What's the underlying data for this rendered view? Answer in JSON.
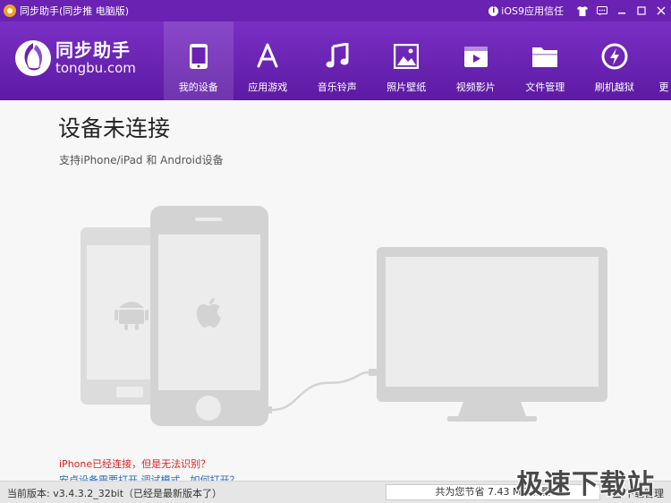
{
  "window": {
    "title": "同步助手(同步推 电脑版)",
    "ios_trust_label": "iOS9应用信任",
    "controls": [
      "shirt-icon",
      "message-icon",
      "minimize-icon",
      "maximize-icon",
      "close-icon"
    ]
  },
  "brand": {
    "name": "同步助手",
    "domain": "tongbu.com"
  },
  "nav": {
    "items": [
      {
        "label": "我的设备",
        "icon": "phone-icon",
        "active": true
      },
      {
        "label": "应用游戏",
        "icon": "appstore-icon",
        "active": false
      },
      {
        "label": "音乐铃声",
        "icon": "music-note-icon",
        "active": false
      },
      {
        "label": "照片壁纸",
        "icon": "picture-icon",
        "active": false
      },
      {
        "label": "视频影片",
        "icon": "film-icon",
        "active": false
      },
      {
        "label": "文件管理",
        "icon": "folder-icon",
        "active": false
      },
      {
        "label": "刷机越狱",
        "icon": "flash-icon",
        "active": false
      },
      {
        "label": "更",
        "icon": "more-icon",
        "active": false
      }
    ]
  },
  "main": {
    "headline": "设备未连接",
    "subline": "支持iPhone/iPad 和 Android设备",
    "link_unrecognized": "iPhone已经连接，但是无法识别？",
    "link_android_debug": "安卓设备需要打开 调试模式，如何打开？"
  },
  "status": {
    "version_text": "当前版本: v3.4.3.2_32bit（已经是最新版本了）",
    "traffic_text": "共为您节省  7.43 MB 流量",
    "download_label": "下载管理"
  },
  "watermark": "极速下载站",
  "colors": {
    "header_purple": "#6a22b3",
    "device_gray": "#d9d9d9",
    "link_red": "#dd2222",
    "link_blue": "#2a6cc0"
  }
}
